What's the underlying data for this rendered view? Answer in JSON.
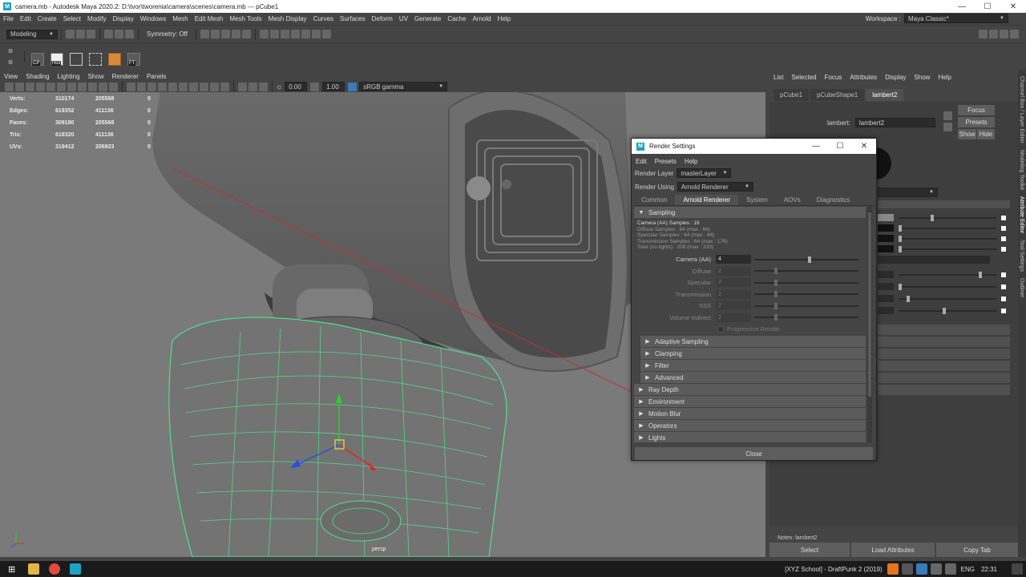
{
  "window": {
    "title": "camera.mb - Autodesk Maya 2020.2: D:\\tvor\\tworenia\\camera\\scenes\\camera.mb  ---  pCube1",
    "minimize": "—",
    "maximize": "☐",
    "close": "✕"
  },
  "menubar": {
    "items": [
      "File",
      "Edit",
      "Create",
      "Select",
      "Modify",
      "Display",
      "Windows",
      "Mesh",
      "Edit Mesh",
      "Mesh Tools",
      "Mesh Display",
      "Curves",
      "Surfaces",
      "Deform",
      "UV",
      "Generate",
      "Cache",
      "Arnold",
      "Help"
    ],
    "workspace_label": "Workspace :",
    "workspace_value": "Maya Classic*"
  },
  "statusline": {
    "mode": "Modeling",
    "symmetry": "Symmetry: Off"
  },
  "shelf": {
    "buttons": [
      {
        "icon": "camera-cp-icon",
        "label": "CP"
      },
      {
        "icon": "history-icon",
        "label": "Hist"
      },
      {
        "icon": "grid-icon",
        "label": ""
      },
      {
        "icon": "move-pivot-icon",
        "label": ""
      },
      {
        "icon": "box-icon",
        "label": ""
      },
      {
        "icon": "freeze-transform-icon",
        "label": "FT"
      }
    ]
  },
  "viewport": {
    "menu": [
      "View",
      "Shading",
      "Lighting",
      "Show",
      "Renderer",
      "Panels"
    ],
    "exposure": "0.00",
    "gamma": "1.00",
    "colorspace": "sRGB gamma",
    "camera_label": "persp",
    "hud": [
      {
        "label": "Verts:",
        "a": "310174",
        "b": "205568",
        "c": "0"
      },
      {
        "label": "Edges:",
        "a": "619352",
        "b": "411136",
        "c": "0"
      },
      {
        "label": "Faces:",
        "a": "309180",
        "b": "205568",
        "c": "0"
      },
      {
        "label": "Tris:",
        "a": "618320",
        "b": "411136",
        "c": "0"
      },
      {
        "label": "UVs:",
        "a": "319412",
        "b": "206923",
        "c": "0"
      }
    ]
  },
  "attribute_editor": {
    "menu": [
      "List",
      "Selected",
      "Focus",
      "Attributes",
      "Display",
      "Show",
      "Help"
    ],
    "tabs": [
      "pCube1",
      "pCubeShape1",
      "lambert2"
    ],
    "active_tab": "lambert2",
    "lambert_label": "lambert:",
    "lambert_value": "lambert2",
    "focus": "Focus",
    "presets": "Presets",
    "show": "Show",
    "hide": "Hide",
    "notes": "Notes:  lambert2",
    "select": "Select",
    "load_attributes": "Load Attributes",
    "copy_tab": "Copy Tab",
    "side_tabs": [
      "Channel Box / Layer Editor",
      "Modeling Toolkit",
      "Attribute Editor",
      "Tool Settings",
      "Outliner"
    ]
  },
  "render_settings": {
    "title": "Render Settings",
    "menu": [
      "Edit",
      "Presets",
      "Help"
    ],
    "render_layer_label": "Render Layer",
    "render_layer_value": "masterLayer",
    "render_using_label": "Render Using",
    "render_using_value": "Arnold Renderer",
    "tabs": [
      "Common",
      "Arnold Renderer",
      "System",
      "AOVs",
      "Diagnostics"
    ],
    "active_tab": "Arnold Renderer",
    "sampling_header": "Sampling",
    "info": {
      "camera": "Camera (AA) Samples : 16",
      "diffuse": "Diffuse Samples : 64 (max : 64)",
      "specular": "Specular Samples : 64 (max : 64)",
      "transmission": "Transmission Samples : 64 (max : 176)",
      "total": "Total (no lights) : 208 (max : 320)"
    },
    "samples": [
      {
        "label": "Camera (AA)",
        "value": "4",
        "slider": 0.53,
        "enabled": true
      },
      {
        "label": "Diffuse",
        "value": "2",
        "slider": 0.2,
        "enabled": false
      },
      {
        "label": "Specular",
        "value": "2",
        "slider": 0.2,
        "enabled": false
      },
      {
        "label": "Transmission",
        "value": "2",
        "slider": 0.2,
        "enabled": false
      },
      {
        "label": "SSS",
        "value": "2",
        "slider": 0.2,
        "enabled": false
      },
      {
        "label": "Volume Indirect",
        "value": "2",
        "slider": 0.2,
        "enabled": false
      }
    ],
    "progressive": "Progressive Render",
    "sub_sections": [
      "Adaptive Sampling",
      "Clamping",
      "Filter",
      "Advanced"
    ],
    "sections": [
      "Ray Depth",
      "Environment",
      "Motion Blur",
      "Operators",
      "Lights"
    ],
    "close": "Close"
  },
  "taskbar": {
    "now_playing": "[XYZ School] - DraftPunk 2 (2019)",
    "language": "ENG",
    "time": "22:31"
  }
}
